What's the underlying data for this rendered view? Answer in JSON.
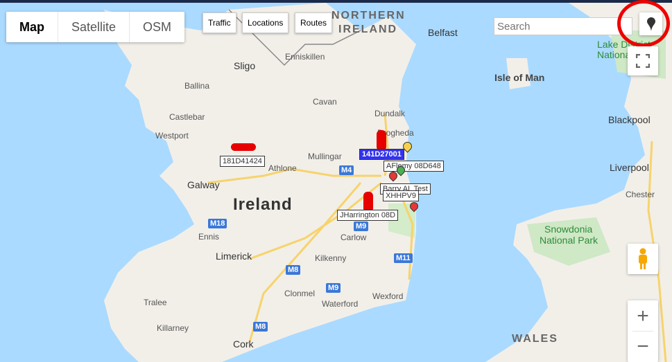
{
  "map_types": [
    {
      "label": "Map",
      "active": true
    },
    {
      "label": "Satellite",
      "active": false
    },
    {
      "label": "OSM",
      "active": false
    }
  ],
  "toolbar": {
    "traffic": "Traffic",
    "locations": "Locations",
    "routes": "Routes"
  },
  "search": {
    "placeholder": "Search"
  },
  "places": {
    "northern_ireland": "NORTHERN",
    "ni2": "IRELAND",
    "ireland": "Ireland",
    "wales": "WALES",
    "isle_of_man": "Isle of Man",
    "belfast": "Belfast",
    "enniskillen": "Enniskillen",
    "sligo": "Sligo",
    "ballina": "Ballina",
    "castlebar": "Castlebar",
    "westport": "Westport",
    "cavan": "Cavan",
    "dundalk": "Dundalk",
    "drogheda": "Drogheda",
    "mullingar": "Mullingar",
    "athlone": "Athlone",
    "galway": "Galway",
    "ennis": "Ennis",
    "limerick": "Limerick",
    "kilkenny": "Kilkenny",
    "carlow": "Carlow",
    "clonmel": "Clonmel",
    "waterford": "Waterford",
    "wexford": "Wexford",
    "tralee": "Tralee",
    "killarney": "Killarney",
    "cork": "Cork",
    "blackpool": "Blackpool",
    "liverpool": "Liverpool",
    "chester": "Chester",
    "lake_district": "Lake District",
    "lake_district2": "National",
    "snowdonia": "Snowdonia",
    "snowdonia2": "National Park"
  },
  "roads": [
    "M4",
    "M18",
    "M9",
    "M8",
    "M11"
  ],
  "vehicles": [
    {
      "label": "181D41424",
      "highlighted": false
    },
    {
      "label": "141D27001",
      "highlighted": true
    },
    {
      "label": "AFlemy 08D648",
      "highlighted": false
    },
    {
      "label": "Barry AL Test",
      "highlighted": false
    },
    {
      "label": "XHHPV9",
      "highlighted": false
    },
    {
      "label": "JHarrington 08D",
      "highlighted": false
    }
  ],
  "colors": {
    "sea": "#aadaff",
    "land": "#f2efe9",
    "highlight": "#3333ee",
    "car": "#e60000",
    "marker_red": "#e53935",
    "marker_yellow": "#f6d04d",
    "marker_green": "#4caf50",
    "annotation": "#ee0000"
  },
  "controls": {
    "zoom_in": "+",
    "zoom_out": "−"
  }
}
